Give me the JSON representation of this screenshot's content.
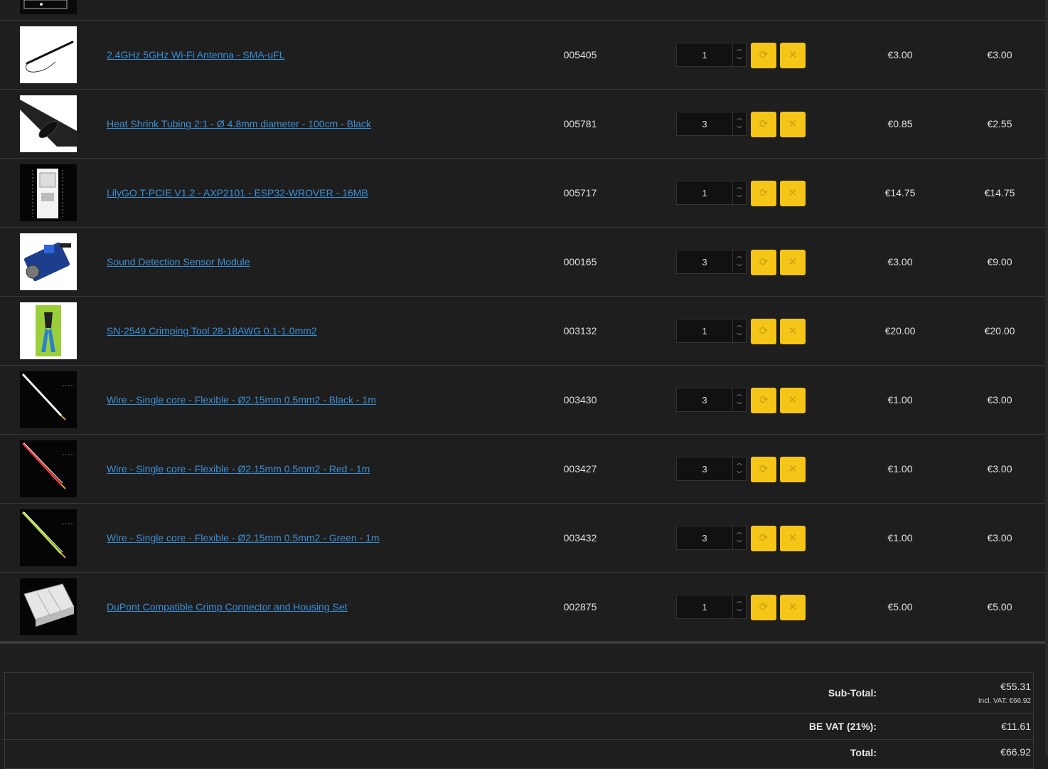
{
  "cart": {
    "rows": [
      {
        "name": "2.4GHz 5GHz Wi-Fi Antenna - SMA-uFL",
        "model": "005405",
        "quantity": "1",
        "unit_price": "€3.00",
        "total": "€3.00",
        "thumb": "antenna-image"
      },
      {
        "name": "Heat Shrink Tubing 2:1 - Ø 4.8mm diameter - 100cm - Black",
        "model": "005781",
        "quantity": "3",
        "unit_price": "€0.85",
        "total": "€2.55",
        "thumb": "heat-shrink-image"
      },
      {
        "name": "LilyGO T-PCIE V1.2 - AXP2101 - ESP32-WROVER - 16MB",
        "model": "005717",
        "quantity": "1",
        "unit_price": "€14.75",
        "total": "€14.75",
        "thumb": "board-image"
      },
      {
        "name": "Sound Detection Sensor Module",
        "model": "000165",
        "quantity": "3",
        "unit_price": "€3.00",
        "total": "€9.00",
        "thumb": "sensor-image"
      },
      {
        "name": "SN-2549 Crimping Tool 28-18AWG 0.1-1.0mm2",
        "model": "003132",
        "quantity": "1",
        "unit_price": "€20.00",
        "total": "€20.00",
        "thumb": "crimp-tool-image"
      },
      {
        "name": "Wire - Single core - Flexible - Ø2.15mm 0.5mm2 - Black - 1m",
        "model": "003430",
        "quantity": "3",
        "unit_price": "€1.00",
        "total": "€3.00",
        "thumb": "wire-black-image"
      },
      {
        "name": "Wire - Single core - Flexible - Ø2.15mm 0.5mm2 - Red - 1m",
        "model": "003427",
        "quantity": "3",
        "unit_price": "€1.00",
        "total": "€3.00",
        "thumb": "wire-red-image"
      },
      {
        "name": "Wire - Single core - Flexible - Ø2.15mm 0.5mm2 - Green - 1m",
        "model": "003432",
        "quantity": "3",
        "unit_price": "€1.00",
        "total": "€3.00",
        "thumb": "wire-green-image"
      },
      {
        "name": "DuPont Compatible Crimp Connector and Housing Set",
        "model": "002875",
        "quantity": "1",
        "unit_price": "€5.00",
        "total": "€5.00",
        "thumb": "connector-set-image"
      }
    ],
    "icons": {
      "update": "refresh-icon",
      "remove": "close-icon",
      "spin_up": "chevron-up-icon",
      "spin_down": "chevron-down-icon"
    }
  },
  "totals": {
    "subtotal_label": "Sub-Total:",
    "subtotal_value": "€55.31",
    "subtotal_note": "Incl. VAT: €66.92",
    "vat_label": "BE VAT (21%):",
    "vat_value": "€11.61",
    "total_label": "Total:",
    "total_value": "€66.92"
  },
  "colors": {
    "background": "#1e1e1e",
    "link": "#3b8fd6",
    "accent_button": "#f5c518"
  }
}
